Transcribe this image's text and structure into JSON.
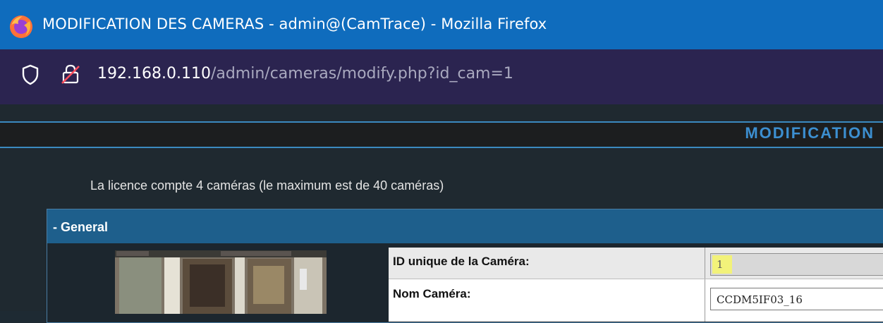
{
  "window": {
    "title": "MODIFICATION DES CAMERAS - admin@(CamTrace) - Mozilla Firefox"
  },
  "urlbar": {
    "host": "192.168.0.110",
    "path": "/admin/cameras/modify.php?id_cam=1"
  },
  "page": {
    "heading": "MODIFICATION",
    "licence_text": "La licence compte 4 caméras (le maximum est de 40 caméras)"
  },
  "general": {
    "section_label": "- General",
    "fields": {
      "id_label": "ID unique de la Caméra:",
      "id_value": "1",
      "name_label": "Nom Caméra:",
      "name_value": "CCDM5IF03_16"
    }
  },
  "colors": {
    "titlebar": "#0f6cbd",
    "urlbar": "#2b2450",
    "accent": "#3c8fd0",
    "panel_header": "#1e5f8c"
  }
}
